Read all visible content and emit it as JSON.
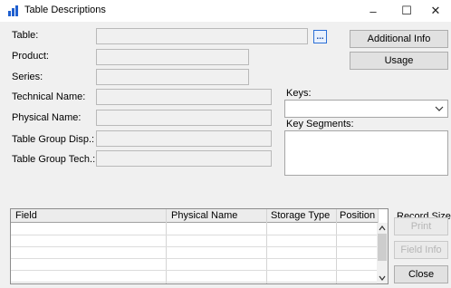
{
  "window": {
    "title": "Table Descriptions",
    "controls": {
      "minimize": "–",
      "maximize": "☐",
      "close": "✕"
    }
  },
  "form": {
    "table_label": "Table:",
    "product_label": "Product:",
    "series_label": "Series:",
    "technical_name_label": "Technical Name:",
    "physical_name_label": "Physical Name:",
    "table_group_disp_label": "Table Group Disp.:",
    "table_group_tech_label": "Table Group Tech.:",
    "ellipsis_label": "..."
  },
  "buttons": {
    "additional_info": "Additional Info",
    "usage": "Usage",
    "print": "Print",
    "field_info": "Field Info",
    "close": "Close"
  },
  "keys": {
    "keys_label": "Keys:",
    "key_segments_label": "Key Segments:"
  },
  "grid": {
    "columns": [
      "Field",
      "Physical Name",
      "Storage Type",
      "Position"
    ],
    "rows": [
      [
        "",
        "",
        "",
        ""
      ],
      [
        "",
        "",
        "",
        ""
      ],
      [
        "",
        "",
        "",
        ""
      ],
      [
        "",
        "",
        "",
        ""
      ],
      [
        "",
        "",
        "",
        ""
      ],
      [
        "",
        "",
        "",
        ""
      ]
    ]
  },
  "record_size": {
    "label": "Record Size:",
    "value": ""
  },
  "colors": {
    "accent": "#1f5fcf",
    "dialog_bg": "#f0f0f0",
    "disabled_text": "#b5b5b5"
  }
}
